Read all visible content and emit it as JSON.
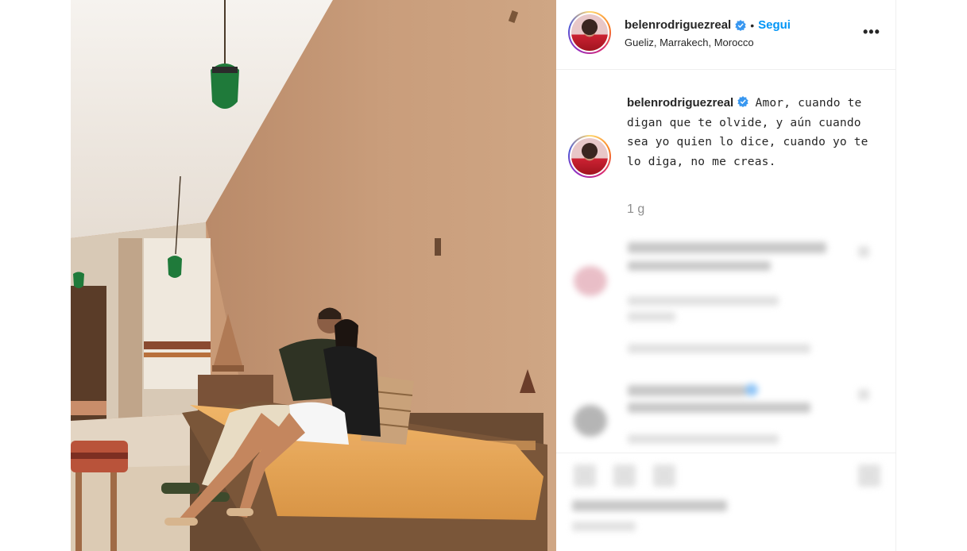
{
  "post": {
    "username": "belenrodriguezreal",
    "follow_label": "Segui",
    "separator": "•",
    "location": "Gueliz, Marrakech, Morocco",
    "more_label": "•••"
  },
  "caption": {
    "username": "belenrodriguezreal",
    "text": "Amor, cuando te digan que te olvide, y aún cuando sea yo quien lo dice, cuando yo te lo diga, no me creas.",
    "time": "1 g"
  },
  "colors": {
    "accent": "#0095f6",
    "verified": "#3897f0",
    "border": "#efefef",
    "muted": "#8e8e8e"
  },
  "icons": {
    "verified": "verified-badge-icon",
    "more": "more-options-icon"
  }
}
